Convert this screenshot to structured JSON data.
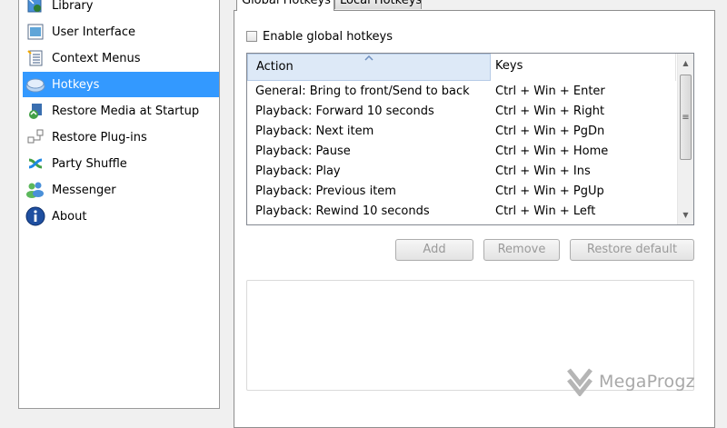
{
  "sidebar": {
    "items": [
      {
        "label": "Library",
        "icon": "library-icon",
        "selected": false
      },
      {
        "label": "User Interface",
        "icon": "user-interface-icon",
        "selected": false
      },
      {
        "label": "Context Menus",
        "icon": "context-menus-icon",
        "selected": false
      },
      {
        "label": "Hotkeys",
        "icon": "hotkeys-icon",
        "selected": true
      },
      {
        "label": "Restore Media at Startup",
        "icon": "restore-media-icon",
        "selected": false
      },
      {
        "label": "Restore Plug-ins",
        "icon": "restore-plugins-icon",
        "selected": false
      },
      {
        "label": "Party Shuffle",
        "icon": "party-shuffle-icon",
        "selected": false
      },
      {
        "label": "Messenger",
        "icon": "messenger-icon",
        "selected": false
      },
      {
        "label": "About",
        "icon": "about-icon",
        "selected": false
      }
    ]
  },
  "tabs": [
    {
      "label": "Global Hotkeys",
      "active": true
    },
    {
      "label": "Local Hotkeys",
      "active": false
    }
  ],
  "global_hotkeys": {
    "enable_label": "Enable global hotkeys",
    "enable_checked": false,
    "columns": {
      "action": "Action",
      "keys": "Keys"
    },
    "sort_column": "action",
    "rows": [
      {
        "action": "General: Bring to front/Send to back",
        "keys": "Ctrl + Win + Enter"
      },
      {
        "action": "Playback: Forward 10 seconds",
        "keys": "Ctrl + Win + Right"
      },
      {
        "action": "Playback: Next item",
        "keys": "Ctrl + Win + PgDn"
      },
      {
        "action": "Playback: Pause",
        "keys": "Ctrl + Win + Home"
      },
      {
        "action": "Playback: Play",
        "keys": "Ctrl + Win + Ins"
      },
      {
        "action": "Playback: Previous item",
        "keys": "Ctrl + Win + PgUp"
      },
      {
        "action": "Playback: Rewind 10 seconds",
        "keys": "Ctrl + Win + Left"
      }
    ],
    "buttons": {
      "add": "Add",
      "remove": "Remove",
      "restore_default": "Restore default"
    }
  },
  "watermark": {
    "text": "MegaProgz"
  },
  "colors": {
    "selection": "#3399ff",
    "header_hover": "#dde9f7",
    "disabled_text": "#9a9a9a"
  }
}
